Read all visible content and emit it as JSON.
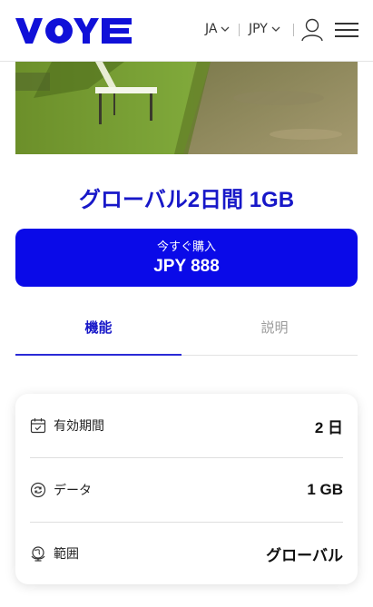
{
  "header": {
    "logo_text": "VOYE",
    "language": "JA",
    "currency": "JPY",
    "icons": {
      "language_dropdown": "chevron-down-icon",
      "currency_dropdown": "chevron-down-icon",
      "account": "user-icon",
      "menu": "hamburger-menu-icon"
    },
    "brand_color": "#1010d8"
  },
  "product": {
    "title": "グローバル2日間 1GB"
  },
  "buy_button": {
    "label": "今すぐ購入",
    "price": "JPY 888",
    "color": "#0a0ae8"
  },
  "tabs": [
    {
      "label": "機能",
      "active": true
    },
    {
      "label": "説明",
      "active": false
    }
  ],
  "features": [
    {
      "icon": "calendar-icon",
      "label": "有効期間",
      "value": "2 日"
    },
    {
      "icon": "data-transfer-icon",
      "label": "データ",
      "value": "1 GB"
    },
    {
      "icon": "globe-icon",
      "label": "範囲",
      "value": "グローバル"
    }
  ]
}
